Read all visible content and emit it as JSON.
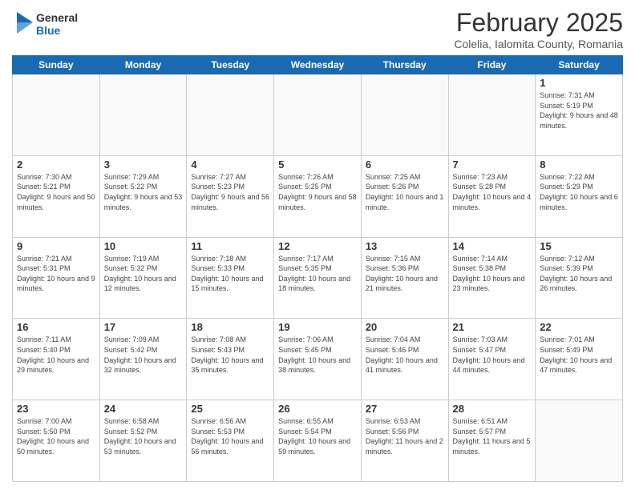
{
  "header": {
    "logo_general": "General",
    "logo_blue": "Blue",
    "month_title": "February 2025",
    "location": "Colelia, Ialomita County, Romania"
  },
  "weekdays": [
    "Sunday",
    "Monday",
    "Tuesday",
    "Wednesday",
    "Thursday",
    "Friday",
    "Saturday"
  ],
  "weeks": [
    [
      {
        "day": "",
        "info": ""
      },
      {
        "day": "",
        "info": ""
      },
      {
        "day": "",
        "info": ""
      },
      {
        "day": "",
        "info": ""
      },
      {
        "day": "",
        "info": ""
      },
      {
        "day": "",
        "info": ""
      },
      {
        "day": "1",
        "info": "Sunrise: 7:31 AM\nSunset: 5:19 PM\nDaylight: 9 hours and 48 minutes."
      }
    ],
    [
      {
        "day": "2",
        "info": "Sunrise: 7:30 AM\nSunset: 5:21 PM\nDaylight: 9 hours and 50 minutes."
      },
      {
        "day": "3",
        "info": "Sunrise: 7:29 AM\nSunset: 5:22 PM\nDaylight: 9 hours and 53 minutes."
      },
      {
        "day": "4",
        "info": "Sunrise: 7:27 AM\nSunset: 5:23 PM\nDaylight: 9 hours and 56 minutes."
      },
      {
        "day": "5",
        "info": "Sunrise: 7:26 AM\nSunset: 5:25 PM\nDaylight: 9 hours and 58 minutes."
      },
      {
        "day": "6",
        "info": "Sunrise: 7:25 AM\nSunset: 5:26 PM\nDaylight: 10 hours and 1 minute."
      },
      {
        "day": "7",
        "info": "Sunrise: 7:23 AM\nSunset: 5:28 PM\nDaylight: 10 hours and 4 minutes."
      },
      {
        "day": "8",
        "info": "Sunrise: 7:22 AM\nSunset: 5:29 PM\nDaylight: 10 hours and 6 minutes."
      }
    ],
    [
      {
        "day": "9",
        "info": "Sunrise: 7:21 AM\nSunset: 5:31 PM\nDaylight: 10 hours and 9 minutes."
      },
      {
        "day": "10",
        "info": "Sunrise: 7:19 AM\nSunset: 5:32 PM\nDaylight: 10 hours and 12 minutes."
      },
      {
        "day": "11",
        "info": "Sunrise: 7:18 AM\nSunset: 5:33 PM\nDaylight: 10 hours and 15 minutes."
      },
      {
        "day": "12",
        "info": "Sunrise: 7:17 AM\nSunset: 5:35 PM\nDaylight: 10 hours and 18 minutes."
      },
      {
        "day": "13",
        "info": "Sunrise: 7:15 AM\nSunset: 5:36 PM\nDaylight: 10 hours and 21 minutes."
      },
      {
        "day": "14",
        "info": "Sunrise: 7:14 AM\nSunset: 5:38 PM\nDaylight: 10 hours and 23 minutes."
      },
      {
        "day": "15",
        "info": "Sunrise: 7:12 AM\nSunset: 5:39 PM\nDaylight: 10 hours and 26 minutes."
      }
    ],
    [
      {
        "day": "16",
        "info": "Sunrise: 7:11 AM\nSunset: 5:40 PM\nDaylight: 10 hours and 29 minutes."
      },
      {
        "day": "17",
        "info": "Sunrise: 7:09 AM\nSunset: 5:42 PM\nDaylight: 10 hours and 32 minutes."
      },
      {
        "day": "18",
        "info": "Sunrise: 7:08 AM\nSunset: 5:43 PM\nDaylight: 10 hours and 35 minutes."
      },
      {
        "day": "19",
        "info": "Sunrise: 7:06 AM\nSunset: 5:45 PM\nDaylight: 10 hours and 38 minutes."
      },
      {
        "day": "20",
        "info": "Sunrise: 7:04 AM\nSunset: 5:46 PM\nDaylight: 10 hours and 41 minutes."
      },
      {
        "day": "21",
        "info": "Sunrise: 7:03 AM\nSunset: 5:47 PM\nDaylight: 10 hours and 44 minutes."
      },
      {
        "day": "22",
        "info": "Sunrise: 7:01 AM\nSunset: 5:49 PM\nDaylight: 10 hours and 47 minutes."
      }
    ],
    [
      {
        "day": "23",
        "info": "Sunrise: 7:00 AM\nSunset: 5:50 PM\nDaylight: 10 hours and 50 minutes."
      },
      {
        "day": "24",
        "info": "Sunrise: 6:58 AM\nSunset: 5:52 PM\nDaylight: 10 hours and 53 minutes."
      },
      {
        "day": "25",
        "info": "Sunrise: 6:56 AM\nSunset: 5:53 PM\nDaylight: 10 hours and 56 minutes."
      },
      {
        "day": "26",
        "info": "Sunrise: 6:55 AM\nSunset: 5:54 PM\nDaylight: 10 hours and 59 minutes."
      },
      {
        "day": "27",
        "info": "Sunrise: 6:53 AM\nSunset: 5:56 PM\nDaylight: 11 hours and 2 minutes."
      },
      {
        "day": "28",
        "info": "Sunrise: 6:51 AM\nSunset: 5:57 PM\nDaylight: 11 hours and 5 minutes."
      },
      {
        "day": "",
        "info": ""
      }
    ]
  ]
}
